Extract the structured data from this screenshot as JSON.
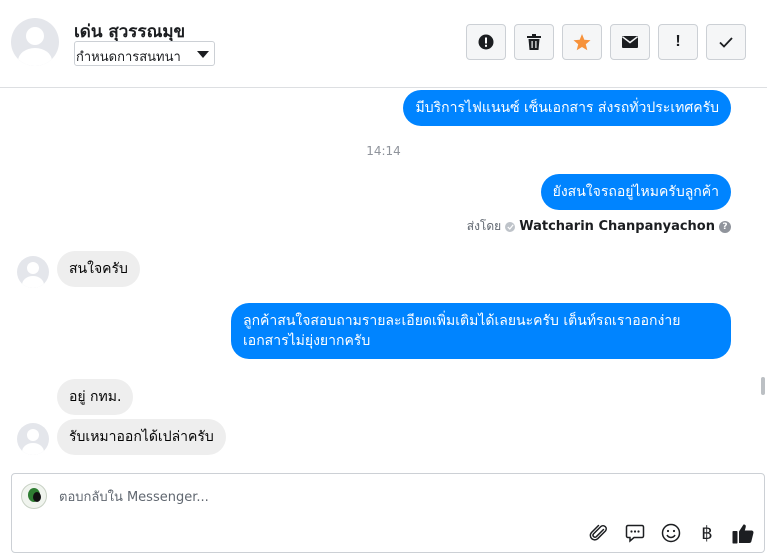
{
  "header": {
    "contact_name": "เด่น สุวรรณมุข",
    "status_select": "กำหนดการสนทนา",
    "buttons": {
      "spam": "spam-icon",
      "delete": "trash-icon",
      "star": "star-icon",
      "unread": "envelope-icon",
      "follow_up": "!",
      "done": "check-icon"
    }
  },
  "conversation": {
    "msg1": "มีบริการไฟแนนซ์ เซ็นเอกสาร ส่งรถทั่วประเทศครับ",
    "timestamp": "14:14",
    "msg2": "ยังสนใจรถอยู่ไหมครับลูกค้า",
    "sent_by_label": "ส่งโดย",
    "sent_by_name": "Watcharin Chanpanyachon",
    "help": "?",
    "msg3": "สนใจครับ",
    "msg4": "ลูกค้าสนใจสอบถามรายละเอียดเพิ่มเติมได้เลยนะครับ เต็นท์รถเราออกง่าย เอกสารไม่ยุ่งยากครับ",
    "msg5": "อยู่ กทม.",
    "msg6": "รับเหมาออกได้เปล่าครับ"
  },
  "composer": {
    "placeholder": "ตอบกลับใน Messenger...",
    "baht_symbol": "฿",
    "icons": [
      "paperclip-icon",
      "saved-reply-icon",
      "emoji-icon",
      "baht-icon",
      "thumbs-up-icon"
    ]
  },
  "colors": {
    "outgoing_bubble": "#0084ff",
    "incoming_bubble": "#eeeeee",
    "star": "#f7923b"
  }
}
